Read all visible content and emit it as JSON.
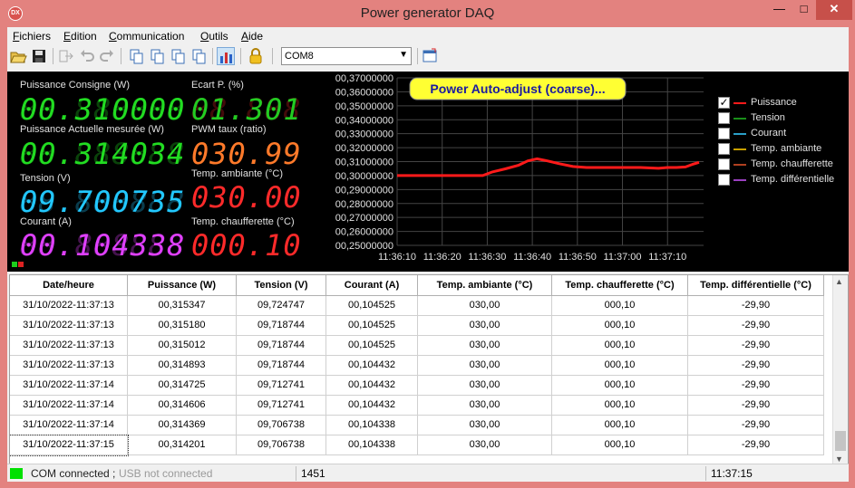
{
  "window": {
    "title": "Power generator DAQ",
    "app_icon_text": "DX"
  },
  "menu": [
    "Fichiers",
    "Edition",
    "Communication",
    "Outils",
    "Aide"
  ],
  "toolbar": {
    "com_port": "COM8"
  },
  "readouts": {
    "consigne": {
      "label": "Puissance Consigne (W)",
      "value": "00.310000",
      "color": "#22dd22"
    },
    "actuelle": {
      "label": "Puissance Actuelle mesurée (W)",
      "value": "00.314034",
      "color": "#22dd22"
    },
    "tension": {
      "label": "Tension (V)",
      "value": "09.700735",
      "color": "#22c8ff"
    },
    "courant": {
      "label": "Courant (A)",
      "value": "00.104338",
      "color": "#e040ff"
    },
    "ecart": {
      "label": "Ecart P. (%)",
      "value": "01.301",
      "color": "#22cc22"
    },
    "pwm": {
      "label": "PWM taux (ratio)",
      "value": "030.99",
      "color": "#ff7a2a"
    },
    "ambiante": {
      "label": "Temp. ambiante (°C)",
      "value": "030.00",
      "color": "#ff2a2a"
    },
    "chaufferette": {
      "label": "Temp. chaufferette (°C)",
      "value": "000.10",
      "color": "#ff2a2a"
    }
  },
  "chart_data": {
    "type": "line",
    "title": "Power Auto-adjust (coarse)...",
    "x": [
      "11:36:10",
      "11:36:20",
      "11:36:30",
      "11:36:40",
      "11:36:50",
      "11:37:00",
      "11:37:10"
    ],
    "y_ticks": [
      "00,37000000",
      "00,36000000",
      "00,35000000",
      "00,34000000",
      "00,33000000",
      "00,32000000",
      "00,31000000",
      "00,30000000",
      "00,29000000",
      "00,28000000",
      "00,27000000",
      "00,26000000",
      "00,25000000"
    ],
    "ylim": [
      0.25,
      0.37
    ],
    "xlim_seconds": [
      0,
      68
    ],
    "series": [
      {
        "name": "Puissance",
        "color": "#ff1a1a",
        "points": [
          [
            0,
            0.3
          ],
          [
            4,
            0.3
          ],
          [
            8,
            0.3
          ],
          [
            12,
            0.3
          ],
          [
            16,
            0.3
          ],
          [
            19,
            0.3
          ],
          [
            21,
            0.3025
          ],
          [
            24,
            0.3048
          ],
          [
            27,
            0.3075
          ],
          [
            29,
            0.3105
          ],
          [
            31,
            0.312
          ],
          [
            33,
            0.3108
          ],
          [
            36,
            0.3085
          ],
          [
            39,
            0.3065
          ],
          [
            42,
            0.3058
          ],
          [
            46,
            0.3058
          ],
          [
            50,
            0.3058
          ],
          [
            54,
            0.3058
          ],
          [
            58,
            0.3052
          ],
          [
            60,
            0.3058
          ],
          [
            62,
            0.3058
          ],
          [
            64,
            0.3062
          ],
          [
            65.5,
            0.308
          ],
          [
            67,
            0.3095
          ],
          [
            69,
            0.313
          ],
          [
            70,
            0.316
          ],
          [
            71,
            0.315
          ],
          [
            73,
            0.3148
          ]
        ]
      }
    ]
  },
  "legend": [
    {
      "label": "Puissance",
      "color": "#ff1a1a",
      "checked": true
    },
    {
      "label": "Tension",
      "color": "#1a8f1a",
      "checked": false
    },
    {
      "label": "Courant",
      "color": "#2aa0c8",
      "checked": false
    },
    {
      "label": "Temp. ambiante",
      "color": "#c8a000",
      "checked": false
    },
    {
      "label": "Temp. chaufferette",
      "color": "#b04020",
      "checked": false
    },
    {
      "label": "Temp. différentielle",
      "color": "#9a40c0",
      "checked": false
    }
  ],
  "table": {
    "headers": [
      "Date/heure",
      "Puissance (W)",
      "Tension (V)",
      "Courant (A)",
      "Temp. ambiante (°C)",
      "Temp. chaufferette (°C)",
      "Temp. différentielle (°C)"
    ],
    "rows": [
      [
        "31/10/2022-11:37:13",
        "00,315347",
        "09,724747",
        "00,104525",
        "030,00",
        "000,10",
        "-29,90"
      ],
      [
        "31/10/2022-11:37:13",
        "00,315180",
        "09,718744",
        "00,104525",
        "030,00",
        "000,10",
        "-29,90"
      ],
      [
        "31/10/2022-11:37:13",
        "00,315012",
        "09,718744",
        "00,104525",
        "030,00",
        "000,10",
        "-29,90"
      ],
      [
        "31/10/2022-11:37:13",
        "00,314893",
        "09,718744",
        "00,104432",
        "030,00",
        "000,10",
        "-29,90"
      ],
      [
        "31/10/2022-11:37:14",
        "00,314725",
        "09,712741",
        "00,104432",
        "030,00",
        "000,10",
        "-29,90"
      ],
      [
        "31/10/2022-11:37:14",
        "00,314606",
        "09,712741",
        "00,104432",
        "030,00",
        "000,10",
        "-29,90"
      ],
      [
        "31/10/2022-11:37:14",
        "00,314369",
        "09,706738",
        "00,104338",
        "030,00",
        "000,10",
        "-29,90"
      ],
      [
        "31/10/2022-11:37:15",
        "00,314201",
        "09,706738",
        "00,104338",
        "030,00",
        "000,10",
        "-29,90"
      ]
    ]
  },
  "status": {
    "com": "COM connected ;",
    "usb": "USB not connected",
    "count": "1451",
    "time": "11:37:15"
  }
}
